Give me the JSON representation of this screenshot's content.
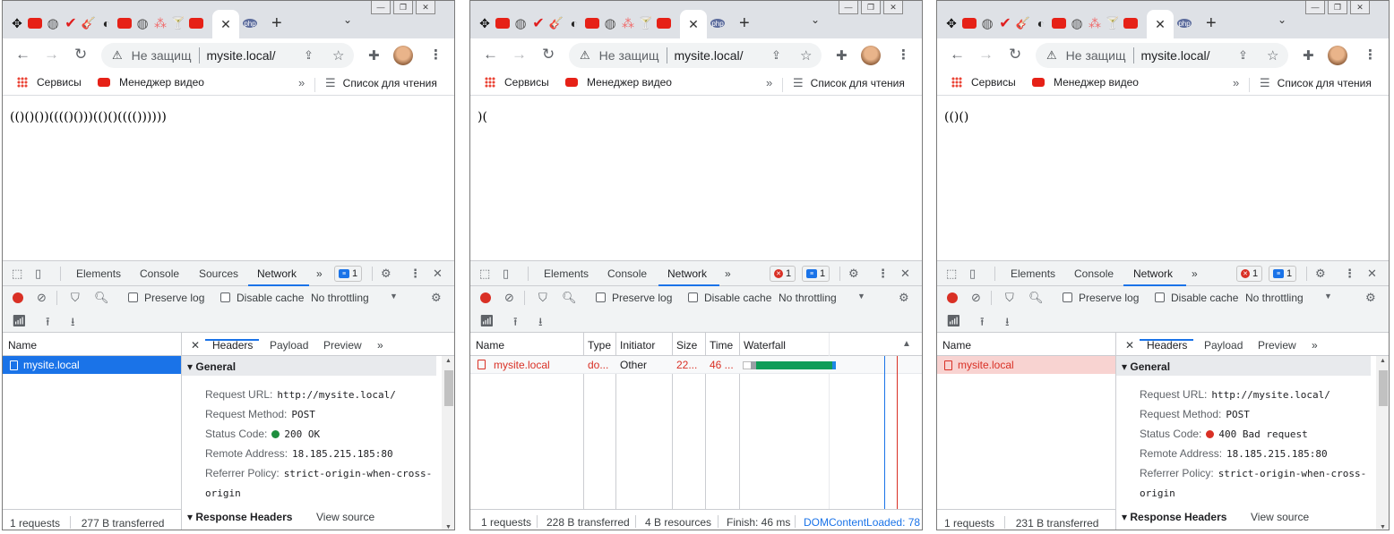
{
  "browser": {
    "address_warning": "Не защищ",
    "url": "mysite.local/",
    "bookmarks": {
      "services": "Сервисы",
      "video_manager": "Менеджер видео",
      "reading_list": "Список для чтения"
    }
  },
  "devtools": {
    "tabs": {
      "elements": "Elements",
      "console": "Console",
      "sources": "Sources",
      "network": "Network"
    },
    "more_tabs": "»",
    "controls": {
      "preserve_log": "Preserve log",
      "disable_cache": "Disable cache",
      "throttling": "No throttling"
    },
    "detail_tabs": {
      "headers": "Headers",
      "payload": "Payload",
      "preview": "Preview"
    },
    "name_header": "Name",
    "general": "General",
    "labels": {
      "request_url": "Request URL:",
      "request_method": "Request Method:",
      "status_code": "Status Code:",
      "remote_address": "Remote Address:",
      "referrer_policy": "Referrer Policy:"
    },
    "response_headers": "Response Headers",
    "view_source": "View source"
  },
  "windows": [
    {
      "page_text": "(()()())(((()()))(()()(((())))))",
      "badge_messages": "1",
      "request_name": "mysite.local",
      "request_url": "http://mysite.local/",
      "request_method": "POST",
      "status_code": "200 OK",
      "status_color": "#1e8e3e",
      "remote_address": "18.185.215.185:80",
      "referrer_policy_line1": "strict-origin-when-cross-",
      "referrer_policy_line2": "origin",
      "footer_requests": "1 requests",
      "footer_transferred": "277 B transferred"
    },
    {
      "page_text": ")(",
      "badge_errors": "1",
      "badge_messages": "1",
      "columns": {
        "name": "Name",
        "type": "Type",
        "initiator": "Initiator",
        "size": "Size",
        "time": "Time",
        "waterfall": "Waterfall"
      },
      "row": {
        "name": "mysite.local",
        "type": "do...",
        "initiator": "Other",
        "size": "22...",
        "time": "46 ..."
      },
      "footer": {
        "requests": "1 requests",
        "transferred": "228 B transferred",
        "resources": "4 B resources",
        "finish": "Finish: 46 ms",
        "dom": "DOMContentLoaded: 78"
      }
    },
    {
      "page_text": "(()()",
      "badge_errors": "1",
      "badge_messages": "1",
      "request_name": "mysite.local",
      "request_url": "http://mysite.local/",
      "request_method": "POST",
      "status_code": "400 Bad request",
      "status_color": "#d93025",
      "remote_address": "18.185.215.185:80",
      "referrer_policy_line1": "strict-origin-when-cross-",
      "referrer_policy_line2": "origin",
      "footer_requests": "1 requests",
      "footer_transferred": "231 B transferred"
    }
  ]
}
